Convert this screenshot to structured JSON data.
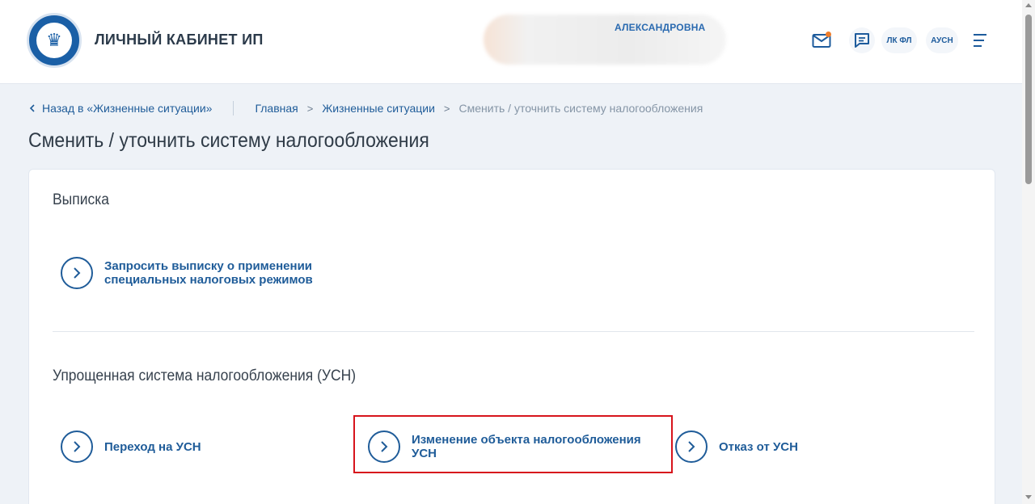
{
  "header": {
    "title": "ЛИЧНЫЙ КАБИНЕТ ИП",
    "user_name": "АЛЕКСАНДРОВНА",
    "buttons": {
      "lk_fl": "ЛК ФЛ",
      "ausn": "АУСН"
    },
    "icons": [
      "tax-service-emblem-icon",
      "mail-icon",
      "chat-icon",
      "menu-icon"
    ],
    "accent_color": "#1f5c99",
    "notification_color": "#ef7d2a"
  },
  "breadcrumbs": {
    "back": "Назад в «Жизненные ситуации»",
    "items": [
      "Главная",
      "Жизненные ситуации",
      "Сменить / уточнить систему налогообложения"
    ]
  },
  "page": {
    "title": "Сменить / уточнить систему налогообложения"
  },
  "sections": [
    {
      "title": "Выписка",
      "actions": [
        {
          "line1": "Запросить выписку о применении",
          "line2": "специальных налоговых режимов"
        }
      ]
    },
    {
      "title": "Упрощенная система налогообложения (УСН)",
      "actions": [
        {
          "line1": "Переход на УСН",
          "line2": ""
        },
        {
          "line1": "Изменение объекта налогообложения",
          "line2": "УСН"
        },
        {
          "line1": "Отказ от УСН",
          "line2": ""
        }
      ]
    }
  ],
  "highlight_color": "#d7141c"
}
